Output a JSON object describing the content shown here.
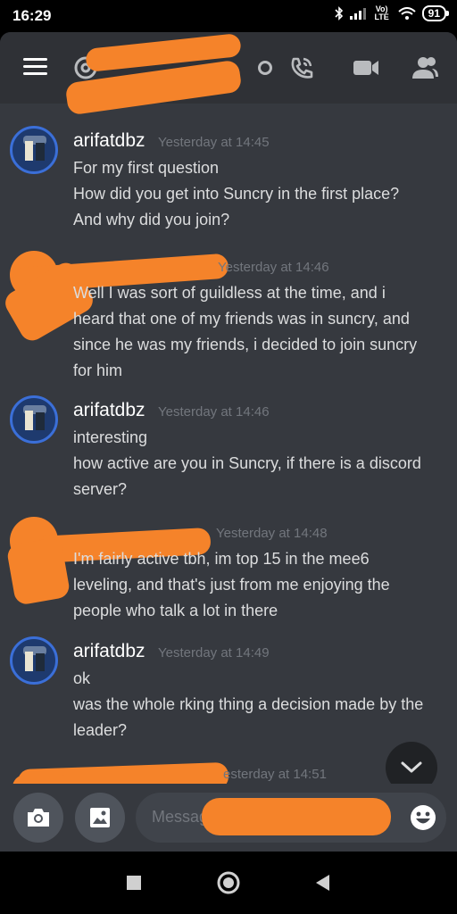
{
  "status_bar": {
    "time": "16:29",
    "network": "Vo) LTE",
    "battery": "91"
  },
  "header": {
    "channel_name": "██████████.",
    "icons": [
      "menu-icon",
      "at-icon",
      "call-icon",
      "video-icon",
      "members-icon"
    ]
  },
  "messages": [
    {
      "author": "arifatdbz",
      "timestamp": "Yesterday at 14:45",
      "lines": [
        "For my first question",
        "How did you get into Suncry in the first place?",
        "And why did you join?"
      ]
    },
    {
      "author": "",
      "timestamp": "Yesterday at 14:46",
      "lines": [
        "Well I was sort of guildless at the time, and i",
        "heard that one of my friends was in suncry, and",
        "since he was my friends, i decided to join suncry",
        "for him"
      ]
    },
    {
      "author": "arifatdbz",
      "timestamp": "Yesterday at 14:46",
      "lines": [
        "interesting",
        "how active are you in Suncry, if there is a discord",
        "server?"
      ]
    },
    {
      "author": "",
      "timestamp": "Yesterday at 14:48",
      "lines": [
        "I'm fairly active tbh, im top 15 in the mee6",
        "leveling, and that's just from me enjoying the",
        "people who talk a lot in there"
      ]
    },
    {
      "author": "arifatdbz",
      "timestamp": "Yesterday at 14:49",
      "lines": [
        "ok",
        "was the whole rking thing a decision made by the",
        "leader?"
      ]
    },
    {
      "author": "",
      "timestamp": "esterday at 14:51",
      "lines": []
    }
  ],
  "composer": {
    "placeholder": "Messag"
  },
  "colors": {
    "background": "#36393f",
    "header": "#2f3136",
    "redaction": "#f5832a",
    "timestamp": "#72767d"
  }
}
